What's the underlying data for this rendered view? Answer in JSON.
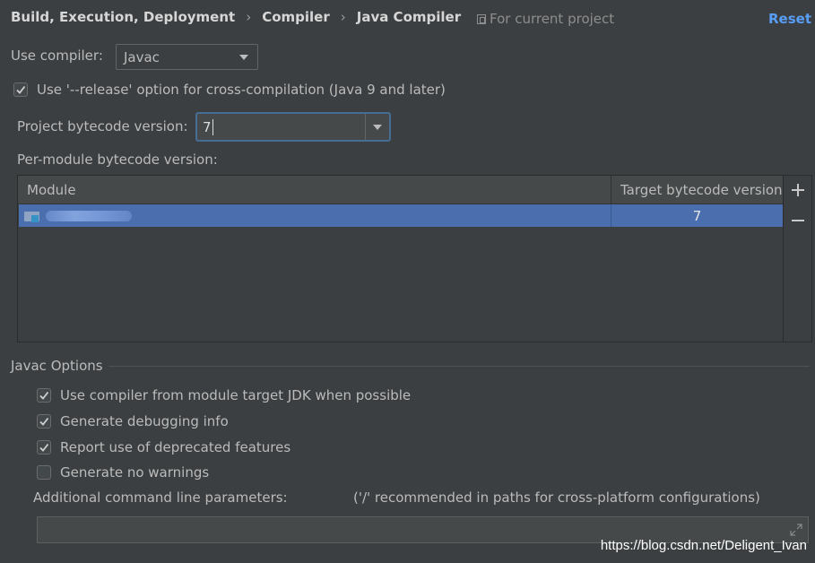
{
  "breadcrumb": [
    "Build, Execution, Deployment",
    "Compiler",
    "Java Compiler"
  ],
  "breadcrumb_separator": "›",
  "scope_label": "For current project",
  "reset_label": "Reset",
  "use_compiler": {
    "label": "Use compiler:",
    "value": "Javac"
  },
  "release_option": {
    "label": "Use '--release' option for cross-compilation (Java 9 and later)",
    "checked": true
  },
  "project_bytecode": {
    "label": "Project bytecode version:",
    "value": "7"
  },
  "per_module_label": "Per-module bytecode version:",
  "table": {
    "columns": [
      "Module",
      "Target bytecode version"
    ],
    "rows": [
      {
        "target": "7",
        "selected": true
      }
    ]
  },
  "javac_options": {
    "title": "Javac Options",
    "checkboxes": [
      {
        "label": "Use compiler from module target JDK when possible",
        "checked": true
      },
      {
        "label": "Generate debugging info",
        "checked": true
      },
      {
        "label": "Report use of deprecated features",
        "checked": true
      },
      {
        "label": "Generate no warnings",
        "checked": false
      }
    ],
    "additional_params_label": "Additional command line parameters:",
    "additional_params_hint": "('/' recommended in paths for cross-platform configurations)",
    "additional_params_value": ""
  },
  "watermark": "https://blog.csdn.net/Deligent_Ivan",
  "colors": {
    "accent": "#589df6",
    "selection": "#4b6eaf",
    "background": "#3c3f41",
    "focus_border": "#466d94"
  }
}
